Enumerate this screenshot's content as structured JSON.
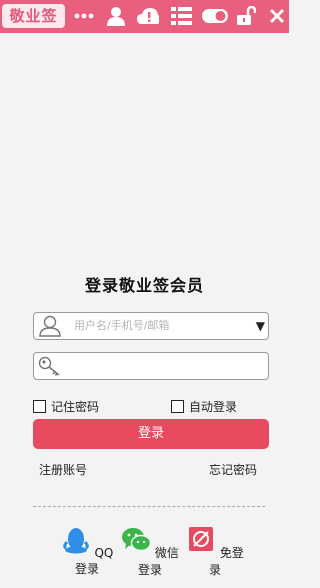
{
  "titlebar": {
    "logo_text": "敬业签",
    "icons": [
      "more-icon",
      "user-icon",
      "cloud-warning-icon",
      "list-icon",
      "toggle-icon",
      "unlock-icon",
      "close-icon"
    ],
    "background": "#e8607e"
  },
  "login": {
    "heading": "登录敬业签会员",
    "username_placeholder": "用户名/手机号/邮箱",
    "dropdown_arrow": "▼",
    "password_value": "",
    "remember_password": "记住密码",
    "auto_login": "自动登录",
    "login_button": "登录",
    "register": "注册账号",
    "forgot_password": "忘记密码",
    "accent": "#e84b5f"
  },
  "social": {
    "qq": "QQ登录",
    "wechat": "微信登录",
    "guest": "免登录"
  }
}
